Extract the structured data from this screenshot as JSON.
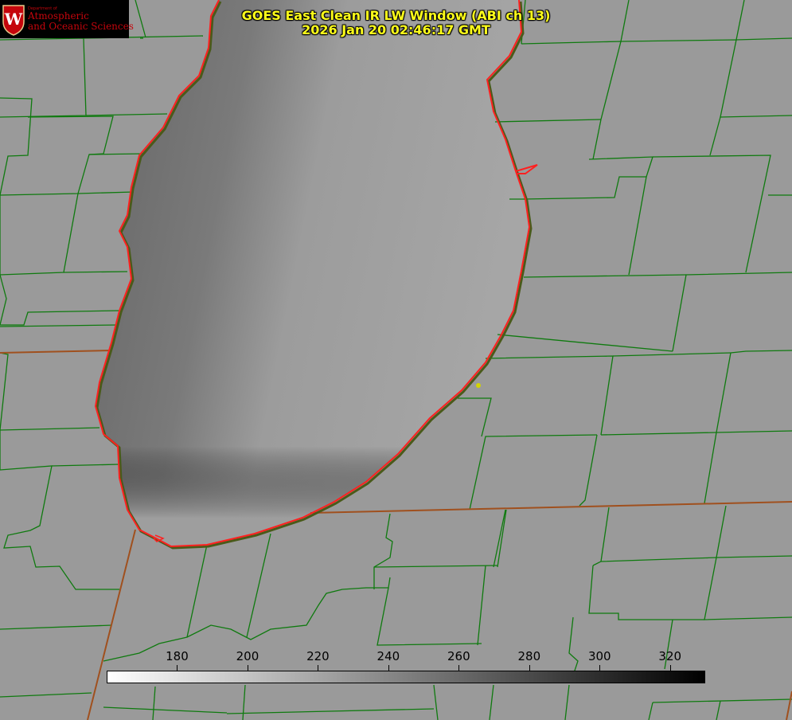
{
  "logo": {
    "dept": "Department of",
    "line1": "Atmospheric",
    "line2": "and Oceanic Sciences",
    "colors": {
      "red": "#c5050c",
      "background": "#000000"
    }
  },
  "title": {
    "line1": "GOES East Clean IR LW Window (ABI ch 13)",
    "line2": "2026 Jan 20 02:46:17 GMT",
    "color": "#ffff1a"
  },
  "colorbar": {
    "min": 160,
    "max": 330,
    "ticks": [
      180,
      200,
      220,
      240,
      260,
      280,
      300,
      320
    ],
    "gradient": [
      "#ffffff",
      "#000000"
    ]
  },
  "map_colors": {
    "land": "#9a9a9a",
    "lake_dark": "#6a6a6a",
    "lake_light": "#a3a3a3",
    "county_lines": "#0f7a0f",
    "coastline": "#ff2020",
    "state_lines": "#a0501e",
    "marker": "#d4d400"
  }
}
